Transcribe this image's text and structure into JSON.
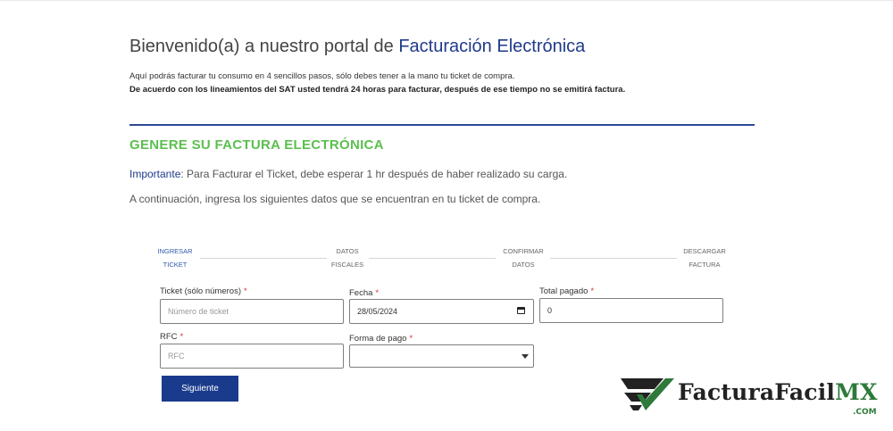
{
  "header": {
    "title_prefix": "Bienvenido(a) a nuestro portal de ",
    "title_accent": "Facturación Electrónica",
    "intro": "Aquí podrás facturar tu consumo en 4 sencillos pasos, sólo debes tener a la mano tu ticket de compra.",
    "notice": "De acuerdo con los lineamientos del SAT usted tendrá 24 horas para facturar, después de ese tiempo no se emitirá factura."
  },
  "section": {
    "title": "GENERE SU FACTURA ELECTRÓNICA",
    "important_label": "Importante",
    "important_text": ": Para Facturar el Ticket, debe esperar 1 hr después de haber realizado su carga.",
    "instructions": "A continuación, ingresa los siguientes datos que se encuentran en tu ticket de compra."
  },
  "steps": [
    {
      "line1": "Ingresar",
      "line2": "Ticket",
      "active": true
    },
    {
      "line1": "Datos",
      "line2": "Fiscales",
      "active": false
    },
    {
      "line1": "Confirmar",
      "line2": "Datos",
      "active": false
    },
    {
      "line1": "Descargar",
      "line2": "Factura",
      "active": false
    }
  ],
  "form": {
    "ticket": {
      "label": "Ticket (sólo números)",
      "required": "*",
      "placeholder": "Número de ticket",
      "value": ""
    },
    "fecha": {
      "label": "Fecha",
      "required": "*",
      "value": "28/05/2024"
    },
    "total": {
      "label": "Total pagado",
      "required": "*",
      "value": "0"
    },
    "rfc": {
      "label": "RFC",
      "required": "*",
      "placeholder": "RFC",
      "value": ""
    },
    "forma_pago": {
      "label": "Forma de pago",
      "required": "*",
      "value": ""
    },
    "submit_label": "Siguiente"
  },
  "brand": {
    "name": "FacturaFacil",
    "name_accent": "MX",
    "domain": ".COM",
    "logo_icon": "checkmark-wings-logo",
    "color_dark": "#222222",
    "color_green": "#2f7a3a"
  },
  "colors": {
    "primary": "#1a3a8c",
    "section_green": "#5cbf4f",
    "required_red": "#dd3333"
  }
}
